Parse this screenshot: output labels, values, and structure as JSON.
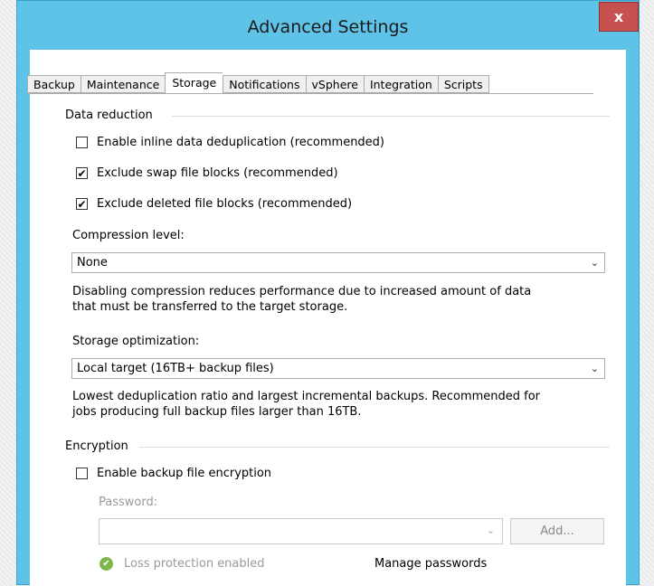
{
  "window": {
    "title": "Advanced Settings",
    "close_glyph": "x"
  },
  "tabs": [
    {
      "label": "Backup",
      "active": false
    },
    {
      "label": "Maintenance",
      "active": false
    },
    {
      "label": "Storage",
      "active": true
    },
    {
      "label": "Notifications",
      "active": false
    },
    {
      "label": "vSphere",
      "active": false
    },
    {
      "label": "Integration",
      "active": false
    },
    {
      "label": "Scripts",
      "active": false
    }
  ],
  "data_reduction": {
    "group_label": "Data reduction",
    "inline_dedup": {
      "label": "Enable inline data deduplication (recommended)",
      "checked": false
    },
    "exclude_swap": {
      "label": "Exclude swap file blocks (recommended)",
      "checked": true
    },
    "exclude_deleted": {
      "label": "Exclude deleted file blocks (recommended)",
      "checked": true
    },
    "compression": {
      "label": "Compression level:",
      "value": "None",
      "description_line1": "Disabling compression reduces performance due to increased amount of data",
      "description_line2": "that must be transferred to the target storage."
    },
    "storage_optimization": {
      "label": "Storage optimization:",
      "value": "Local target (16TB+ backup files)",
      "description_line1": "Lowest deduplication ratio and largest incremental backups. Recommended for",
      "description_line2": "jobs producing full backup files larger than 16TB."
    }
  },
  "encryption": {
    "group_label": "Encryption",
    "enable": {
      "label": "Enable backup file encryption",
      "checked": false
    },
    "password_label": "Password:",
    "password_value": "",
    "add_button": "Add...",
    "loss_protection": "Loss protection enabled",
    "manage_passwords": "Manage passwords"
  },
  "glyphs": {
    "check": "✔",
    "chevron": "⌄",
    "ok": "✔"
  },
  "colors": {
    "titlebar": "#5fc3e8",
    "close": "#c75050",
    "status_ok": "#7db64b"
  }
}
